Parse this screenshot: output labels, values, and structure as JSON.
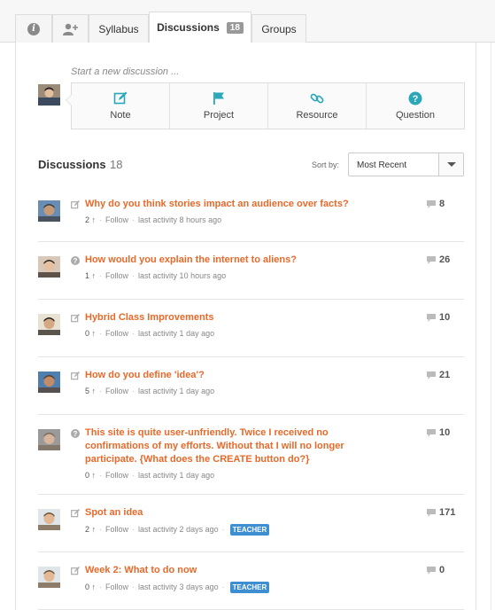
{
  "tabs": [
    {
      "kind": "info-icon",
      "label": ""
    },
    {
      "kind": "user-add-icon",
      "label": ""
    },
    {
      "kind": "text",
      "label": "Syllabus"
    },
    {
      "kind": "text",
      "label": "Discussions",
      "badge": "18",
      "active": true
    },
    {
      "kind": "text",
      "label": "Groups"
    }
  ],
  "composer": {
    "prompt": "Start a new discussion ...",
    "types": [
      {
        "label": "Note",
        "icon": "pencil-icon"
      },
      {
        "label": "Project",
        "icon": "flag-icon"
      },
      {
        "label": "Resource",
        "icon": "link-icon"
      },
      {
        "label": "Question",
        "icon": "question-icon"
      }
    ]
  },
  "list": {
    "heading": "Discussions",
    "count": "18",
    "sort_label": "Sort by:",
    "sort_value": "Most Recent"
  },
  "discussions": [
    {
      "kind": "note",
      "title": "Why do you think stories impact an audience over facts?",
      "votes": "2",
      "follow": "Follow",
      "activity": "last activity 8 hours ago",
      "teacher": "",
      "replies": "8"
    },
    {
      "kind": "question",
      "title": "How would you explain the internet to aliens?",
      "votes": "1",
      "follow": "Follow",
      "activity": "last activity 10 hours ago",
      "teacher": "",
      "replies": "26"
    },
    {
      "kind": "note",
      "title": "Hybrid Class Improvements",
      "votes": "0",
      "follow": "Follow",
      "activity": "last activity 1 day ago",
      "teacher": "",
      "replies": "10"
    },
    {
      "kind": "note",
      "title": "How do you define 'idea'?",
      "votes": "5",
      "follow": "Follow",
      "activity": "last activity 1 day ago",
      "teacher": "",
      "replies": "21"
    },
    {
      "kind": "question",
      "title": "This site is quite user-unfriendly. Twice I received no confirmations of my efforts. Without that I will no longer participate. {What does the CREATE button do?}",
      "votes": "0",
      "follow": "Follow",
      "activity": "last activity 1 day ago",
      "teacher": "",
      "replies": "10"
    },
    {
      "kind": "note",
      "title": "Spot an idea",
      "votes": "2",
      "follow": "Follow",
      "activity": "last activity 2 days ago",
      "teacher": "TEACHER",
      "replies": "171"
    },
    {
      "kind": "note",
      "title": "Week 2: What to do now",
      "votes": "0",
      "follow": "Follow",
      "activity": "last activity 3 days ago",
      "teacher": "TEACHER",
      "replies": "0"
    }
  ],
  "colors": {
    "accent": "#e8692a",
    "teacher_badge": "#3d8fd1",
    "icon_teal": "#2aa7b8"
  }
}
